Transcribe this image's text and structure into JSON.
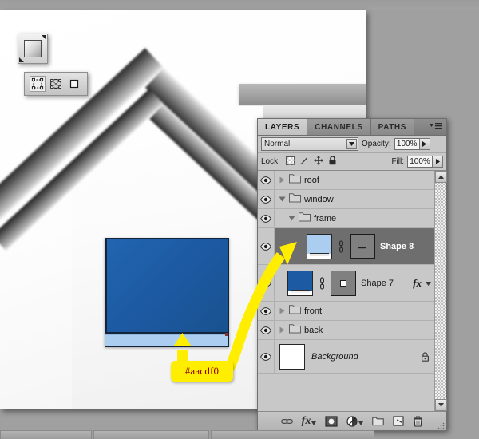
{
  "app": {
    "workspace_bg": "#a0a0a0",
    "canvas_bg": "#ffffff"
  },
  "tools": {
    "swatch": {
      "name": "gradient-swatch",
      "tooltip": "Gradient"
    },
    "path_toolbar": {
      "buttons": [
        {
          "name": "free-transform-path",
          "label": "",
          "active": true
        },
        {
          "name": "warp-path",
          "label": "",
          "active": false
        },
        {
          "name": "commit-path",
          "label": "",
          "active": false
        }
      ]
    }
  },
  "annotation": {
    "callout_text": "#aacdf0",
    "callout_bg": "#ffee00",
    "callout_fg": "#8b0000",
    "arrow_color": "#ffee00"
  },
  "artwork": {
    "window_glass_color": "#1d5aa4",
    "window_sill_color": "#aacdf0",
    "window_frame_color": "#14243a",
    "roof_color_light": "#f4f4f4",
    "roof_color_dark": "#2e2e2e"
  },
  "panel": {
    "tabs": [
      {
        "label": "LAYERS",
        "active": true
      },
      {
        "label": "CHANNELS",
        "active": false
      },
      {
        "label": "PATHS",
        "active": false
      }
    ],
    "menu_icon": "panel-menu-icon",
    "blend": {
      "mode_label": "Normal",
      "opacity_label": "Opacity:",
      "opacity_value": "100%",
      "fill_label": "Fill:",
      "fill_value": "100%"
    },
    "lock": {
      "label": "Lock:",
      "icons": [
        "lock-transparent-pixels-icon",
        "lock-image-pixels-icon",
        "lock-position-icon",
        "lock-all-icon"
      ]
    },
    "layers": [
      {
        "type": "group",
        "name": "roof",
        "expanded": false,
        "indent": 0,
        "visible": true,
        "selected": false
      },
      {
        "type": "group",
        "name": "window",
        "expanded": true,
        "indent": 0,
        "visible": true,
        "selected": false
      },
      {
        "type": "group",
        "name": "frame",
        "expanded": true,
        "indent": 1,
        "visible": true,
        "selected": false
      },
      {
        "type": "shape",
        "name": "Shape 8",
        "visible": true,
        "selected": true,
        "thumb_color": "#aacdf0",
        "linked": true,
        "mask": "vector-mask-dash",
        "has_fx": false
      },
      {
        "type": "shape",
        "name": "Shape 7",
        "visible": true,
        "selected": false,
        "thumb_color": "#1d5aa4",
        "linked": true,
        "mask": "vector-mask-square",
        "has_fx": true,
        "fx_label": "fx"
      },
      {
        "type": "group",
        "name": "front",
        "expanded": false,
        "indent": 0,
        "visible": true,
        "selected": false
      },
      {
        "type": "group",
        "name": "back",
        "expanded": false,
        "indent": 0,
        "visible": true,
        "selected": false
      },
      {
        "type": "background",
        "name": "Background",
        "visible": true,
        "selected": false,
        "thumb_color": "#ffffff",
        "locked": true
      }
    ],
    "bottom_buttons": [
      {
        "name": "link-layers-button",
        "icon": "link-icon"
      },
      {
        "name": "add-layer-style-button",
        "icon": "fx-icon"
      },
      {
        "name": "add-layer-mask-button",
        "icon": "mask-icon"
      },
      {
        "name": "new-fill-adjustment-button",
        "icon": "adjustment-icon"
      },
      {
        "name": "new-group-button",
        "icon": "folder-icon"
      },
      {
        "name": "new-layer-button",
        "icon": "new-layer-icon"
      },
      {
        "name": "delete-layer-button",
        "icon": "trash-icon"
      }
    ]
  }
}
